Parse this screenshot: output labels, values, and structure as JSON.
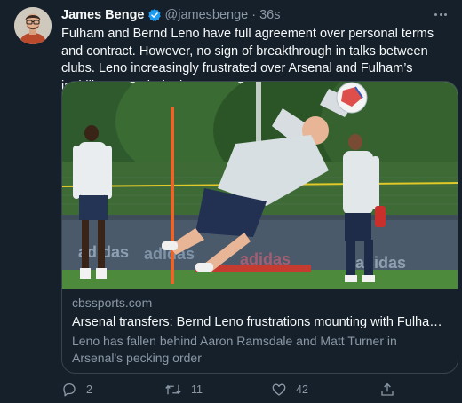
{
  "author": {
    "name": "James Benge",
    "handle": "@jamesbenge",
    "time": "36s",
    "verified_color": "#1d9bf0",
    "avatar_icon": "person-avatar-icon"
  },
  "tweet": {
    "text": "Fulham and Bernd Leno have full agreement over personal terms and contract. However, no sign of breakthrough in talks between clubs. Leno increasingly frustrated over Arsenal and Fulham’s inability to reach deal."
  },
  "card": {
    "image_icon": "goalkeeper-training-photo",
    "domain": "cbssports.com",
    "title": "Arsenal transfers: Bernd Leno frustrations mounting with Fulham at i...",
    "description": "Leno has fallen behind Aaron Ramsdale and Matt Turner in Arsenal's pecking order"
  },
  "actions": {
    "reply_count": "2",
    "retweet_count": "11",
    "like_count": "42",
    "reply_icon": "reply-icon",
    "retweet_icon": "retweet-icon",
    "like_icon": "heart-icon",
    "share_icon": "share-icon"
  },
  "colors": {
    "background": "#15202b",
    "text": "#f7f9f9",
    "secondary": "#8b98a5",
    "border": "#38444d",
    "accent": "#1d9bf0"
  }
}
